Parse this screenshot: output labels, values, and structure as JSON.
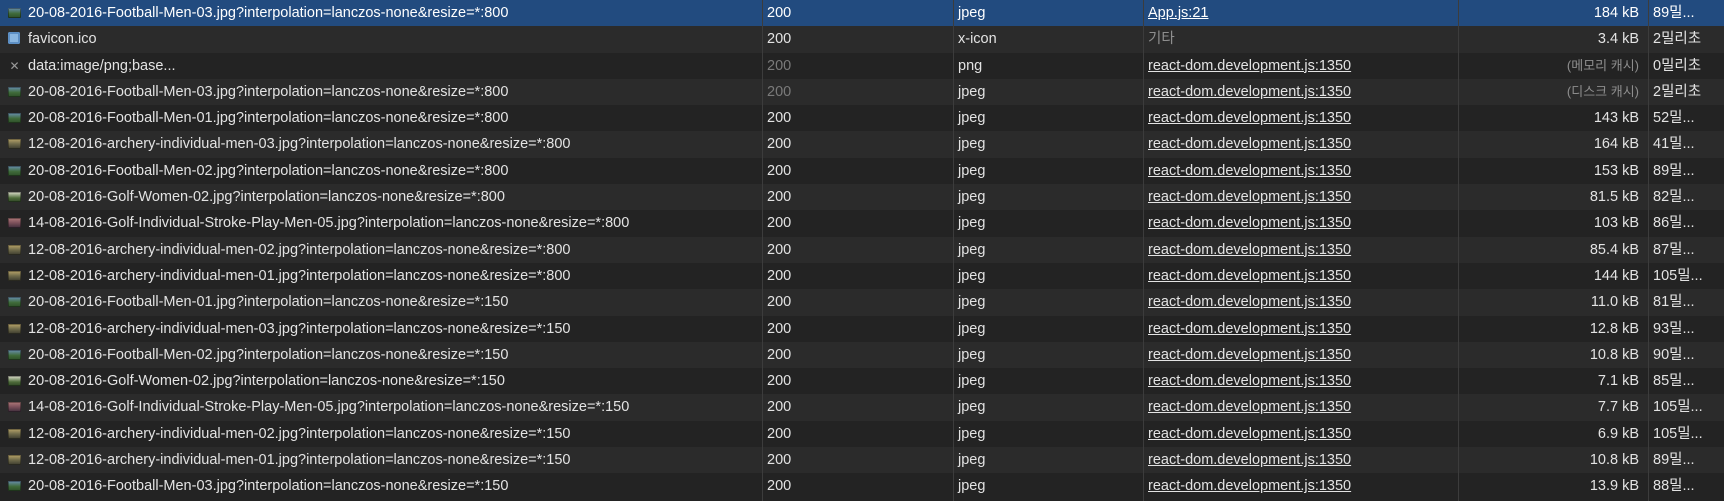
{
  "colors": {
    "background": "#232323",
    "row_alt": "#2b2b2b",
    "selected": "#224b7f"
  },
  "requests": [
    {
      "name": "20-08-2016-Football-Men-03.jpg?interpolation=lanczos-none&resize=*:800",
      "status": "200",
      "type": "jpeg",
      "initiator": "App.js:21",
      "size": "184 kB",
      "time": "89밀...",
      "icon": "image-thumbnail-icon",
      "selected": true
    },
    {
      "name": "favicon.ico",
      "status": "200",
      "type": "x-icon",
      "initiator": "기타",
      "size": "3.4 kB",
      "time": "2밀리초",
      "icon": "favicon-icon"
    },
    {
      "name": "data:image/png;base...",
      "status": "200",
      "type": "png",
      "initiator": "react-dom.development.js:1350",
      "size": "(메모리 캐시)",
      "time": "0밀리초",
      "icon": "broken-image-icon",
      "status_dim": true
    },
    {
      "name": "20-08-2016-Football-Men-03.jpg?interpolation=lanczos-none&resize=*:800",
      "status": "200",
      "type": "jpeg",
      "initiator": "react-dom.development.js:1350",
      "size": "(디스크 캐시)",
      "time": "2밀리초",
      "icon": "image-thumbnail-icon",
      "status_dim": true
    },
    {
      "name": "20-08-2016-Football-Men-01.jpg?interpolation=lanczos-none&resize=*:800",
      "status": "200",
      "type": "jpeg",
      "initiator": "react-dom.development.js:1350",
      "size": "143 kB",
      "time": "52밀...",
      "icon": "image-thumbnail-icon"
    },
    {
      "name": "12-08-2016-archery-individual-men-03.jpg?interpolation=lanczos-none&resize=*:800",
      "status": "200",
      "type": "jpeg",
      "initiator": "react-dom.development.js:1350",
      "size": "164 kB",
      "time": "41밀...",
      "icon": "image-thumbnail-icon"
    },
    {
      "name": "20-08-2016-Football-Men-02.jpg?interpolation=lanczos-none&resize=*:800",
      "status": "200",
      "type": "jpeg",
      "initiator": "react-dom.development.js:1350",
      "size": "153 kB",
      "time": "89밀...",
      "icon": "image-thumbnail-icon"
    },
    {
      "name": "20-08-2016-Golf-Women-02.jpg?interpolation=lanczos-none&resize=*:800",
      "status": "200",
      "type": "jpeg",
      "initiator": "react-dom.development.js:1350",
      "size": "81.5 kB",
      "time": "82밀...",
      "icon": "image-thumbnail-icon"
    },
    {
      "name": "14-08-2016-Golf-Individual-Stroke-Play-Men-05.jpg?interpolation=lanczos-none&resize=*:800",
      "status": "200",
      "type": "jpeg",
      "initiator": "react-dom.development.js:1350",
      "size": "103 kB",
      "time": "86밀...",
      "icon": "image-thumbnail-icon"
    },
    {
      "name": "12-08-2016-archery-individual-men-02.jpg?interpolation=lanczos-none&resize=*:800",
      "status": "200",
      "type": "jpeg",
      "initiator": "react-dom.development.js:1350",
      "size": "85.4 kB",
      "time": "87밀...",
      "icon": "image-thumbnail-icon"
    },
    {
      "name": "12-08-2016-archery-individual-men-01.jpg?interpolation=lanczos-none&resize=*:800",
      "status": "200",
      "type": "jpeg",
      "initiator": "react-dom.development.js:1350",
      "size": "144 kB",
      "time": "105밀...",
      "icon": "image-thumbnail-icon"
    },
    {
      "name": "20-08-2016-Football-Men-01.jpg?interpolation=lanczos-none&resize=*:150",
      "status": "200",
      "type": "jpeg",
      "initiator": "react-dom.development.js:1350",
      "size": "11.0 kB",
      "time": "81밀...",
      "icon": "image-thumbnail-icon"
    },
    {
      "name": "12-08-2016-archery-individual-men-03.jpg?interpolation=lanczos-none&resize=*:150",
      "status": "200",
      "type": "jpeg",
      "initiator": "react-dom.development.js:1350",
      "size": "12.8 kB",
      "time": "93밀...",
      "icon": "image-thumbnail-icon"
    },
    {
      "name": "20-08-2016-Football-Men-02.jpg?interpolation=lanczos-none&resize=*:150",
      "status": "200",
      "type": "jpeg",
      "initiator": "react-dom.development.js:1350",
      "size": "10.8 kB",
      "time": "90밀...",
      "icon": "image-thumbnail-icon"
    },
    {
      "name": "20-08-2016-Golf-Women-02.jpg?interpolation=lanczos-none&resize=*:150",
      "status": "200",
      "type": "jpeg",
      "initiator": "react-dom.development.js:1350",
      "size": "7.1 kB",
      "time": "85밀...",
      "icon": "image-thumbnail-icon"
    },
    {
      "name": "14-08-2016-Golf-Individual-Stroke-Play-Men-05.jpg?interpolation=lanczos-none&resize=*:150",
      "status": "200",
      "type": "jpeg",
      "initiator": "react-dom.development.js:1350",
      "size": "7.7 kB",
      "time": "105밀...",
      "icon": "image-thumbnail-icon"
    },
    {
      "name": "12-08-2016-archery-individual-men-02.jpg?interpolation=lanczos-none&resize=*:150",
      "status": "200",
      "type": "jpeg",
      "initiator": "react-dom.development.js:1350",
      "size": "6.9 kB",
      "time": "105밀...",
      "icon": "image-thumbnail-icon"
    },
    {
      "name": "12-08-2016-archery-individual-men-01.jpg?interpolation=lanczos-none&resize=*:150",
      "status": "200",
      "type": "jpeg",
      "initiator": "react-dom.development.js:1350",
      "size": "10.8 kB",
      "time": "89밀...",
      "icon": "image-thumbnail-icon"
    },
    {
      "name": "20-08-2016-Football-Men-03.jpg?interpolation=lanczos-none&resize=*:150",
      "status": "200",
      "type": "jpeg",
      "initiator": "react-dom.development.js:1350",
      "size": "13.9 kB",
      "time": "88밀...",
      "icon": "image-thumbnail-icon"
    }
  ]
}
